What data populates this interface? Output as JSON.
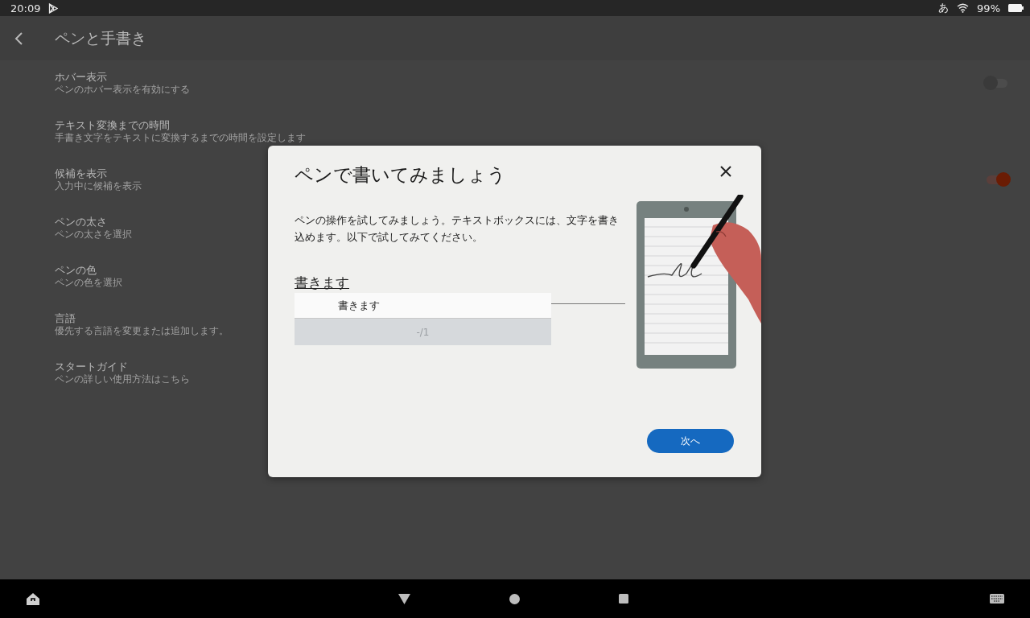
{
  "status_bar": {
    "time": "20:09",
    "ime": "あ",
    "battery": "99%"
  },
  "app_bar": {
    "title": "ペンと手書き"
  },
  "settings": [
    {
      "title": "ホバー表示",
      "subtitle": "ペンのホバー表示を有効にする",
      "kind": "toggle",
      "on": false
    },
    {
      "title": "テキスト変換までの時間",
      "subtitle": "手書き文字をテキストに変換するまでの時間を設定します",
      "kind": "plain"
    },
    {
      "title": "候補を表示",
      "subtitle": "入力中に候補を表示",
      "kind": "toggle",
      "on": true
    },
    {
      "title": "ペンの太さ",
      "subtitle": "ペンの太さを選択",
      "kind": "plain"
    },
    {
      "title": "ペンの色",
      "subtitle": "ペンの色を選択",
      "kind": "plain"
    },
    {
      "title": "言語",
      "subtitle": "優先する言語を変更または追加します。",
      "kind": "plain"
    },
    {
      "title": "スタートガイド",
      "subtitle": "ペンの詳しい使用方法はこちら",
      "kind": "plain"
    }
  ],
  "dialog": {
    "title": "ペンで書いてみましょう",
    "description": "ペンの操作を試してみましょう。テキストボックスには、文字を書き込めます。以下で試してみてください。",
    "heading": "書きます",
    "input": {
      "value": "書きます"
    },
    "counter": "-/1",
    "next_button": "次へ"
  }
}
